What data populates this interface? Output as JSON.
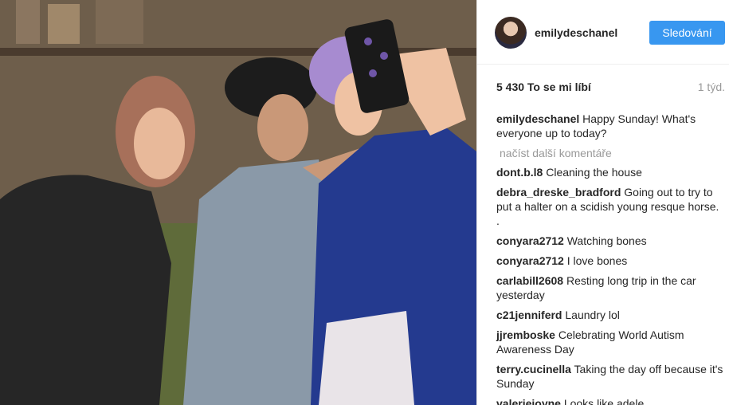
{
  "post": {
    "username": "emilydeschanel",
    "follow_label": "Sledování",
    "likes": "5 430 To se mi líbí",
    "time": "1 týd."
  },
  "caption": {
    "user": "emilydeschanel",
    "text": "Happy Sunday! What's everyone up to today?"
  },
  "load_more": "načíst další komentáře",
  "comments": [
    {
      "user": "dont.b.l8",
      "text": "Cleaning the house"
    },
    {
      "user": "debra_dreske_bradford",
      "text": "Going out to try to put a halter on a scidish young resque horse. ."
    },
    {
      "user": "conyara2712",
      "text": "Watching bones"
    },
    {
      "user": "conyara2712",
      "text": "I love bones"
    },
    {
      "user": "carlabill2608",
      "text": "Resting long trip in the car yesterday"
    },
    {
      "user": "c21jenniferd",
      "text": "Laundry lol"
    },
    {
      "user": "jjremboske",
      "text": "Celebrating World Autism Awareness Day"
    },
    {
      "user": "terry.cucinella",
      "text": "Taking the day off because it's Sunday"
    },
    {
      "user": "valeriejoyne",
      "text": "Looks like adele"
    }
  ]
}
